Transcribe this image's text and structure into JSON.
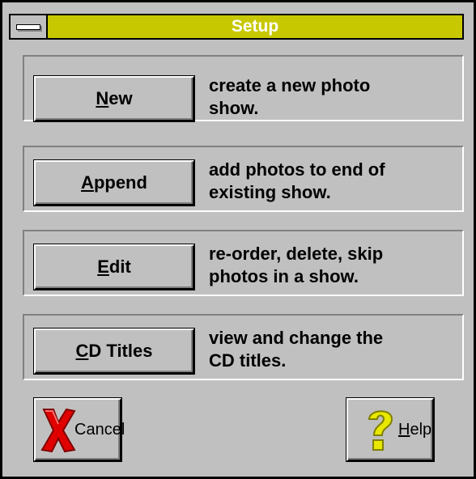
{
  "window": {
    "title": "Setup"
  },
  "actions": [
    {
      "name": "new",
      "mnemonic": "N",
      "rest": "ew",
      "desc_line1": "create a new photo",
      "desc_line2": "show."
    },
    {
      "name": "append",
      "mnemonic": "A",
      "rest": "ppend",
      "desc_line1": "add photos to end of",
      "desc_line2": "existing show."
    },
    {
      "name": "edit",
      "mnemonic": "E",
      "rest": "dit",
      "desc_line1": "re-order, delete, skip",
      "desc_line2": "photos in a show."
    },
    {
      "name": "cd-titles",
      "mnemonic": "C",
      "rest": "D Titles",
      "desc_line1": "view and change the",
      "desc_line2": "CD titles."
    }
  ],
  "footer": {
    "cancel": {
      "mnemonic": "C",
      "rest": "ancel",
      "icon": "red-x-icon"
    },
    "help": {
      "mnemonic": "H",
      "rest": "elp",
      "icon": "question-mark-icon"
    }
  },
  "colors": {
    "titlebar": "#c8c800",
    "face": "#c0c0c0",
    "cancel_icon": "#e00000",
    "help_icon": "#e8e800"
  }
}
